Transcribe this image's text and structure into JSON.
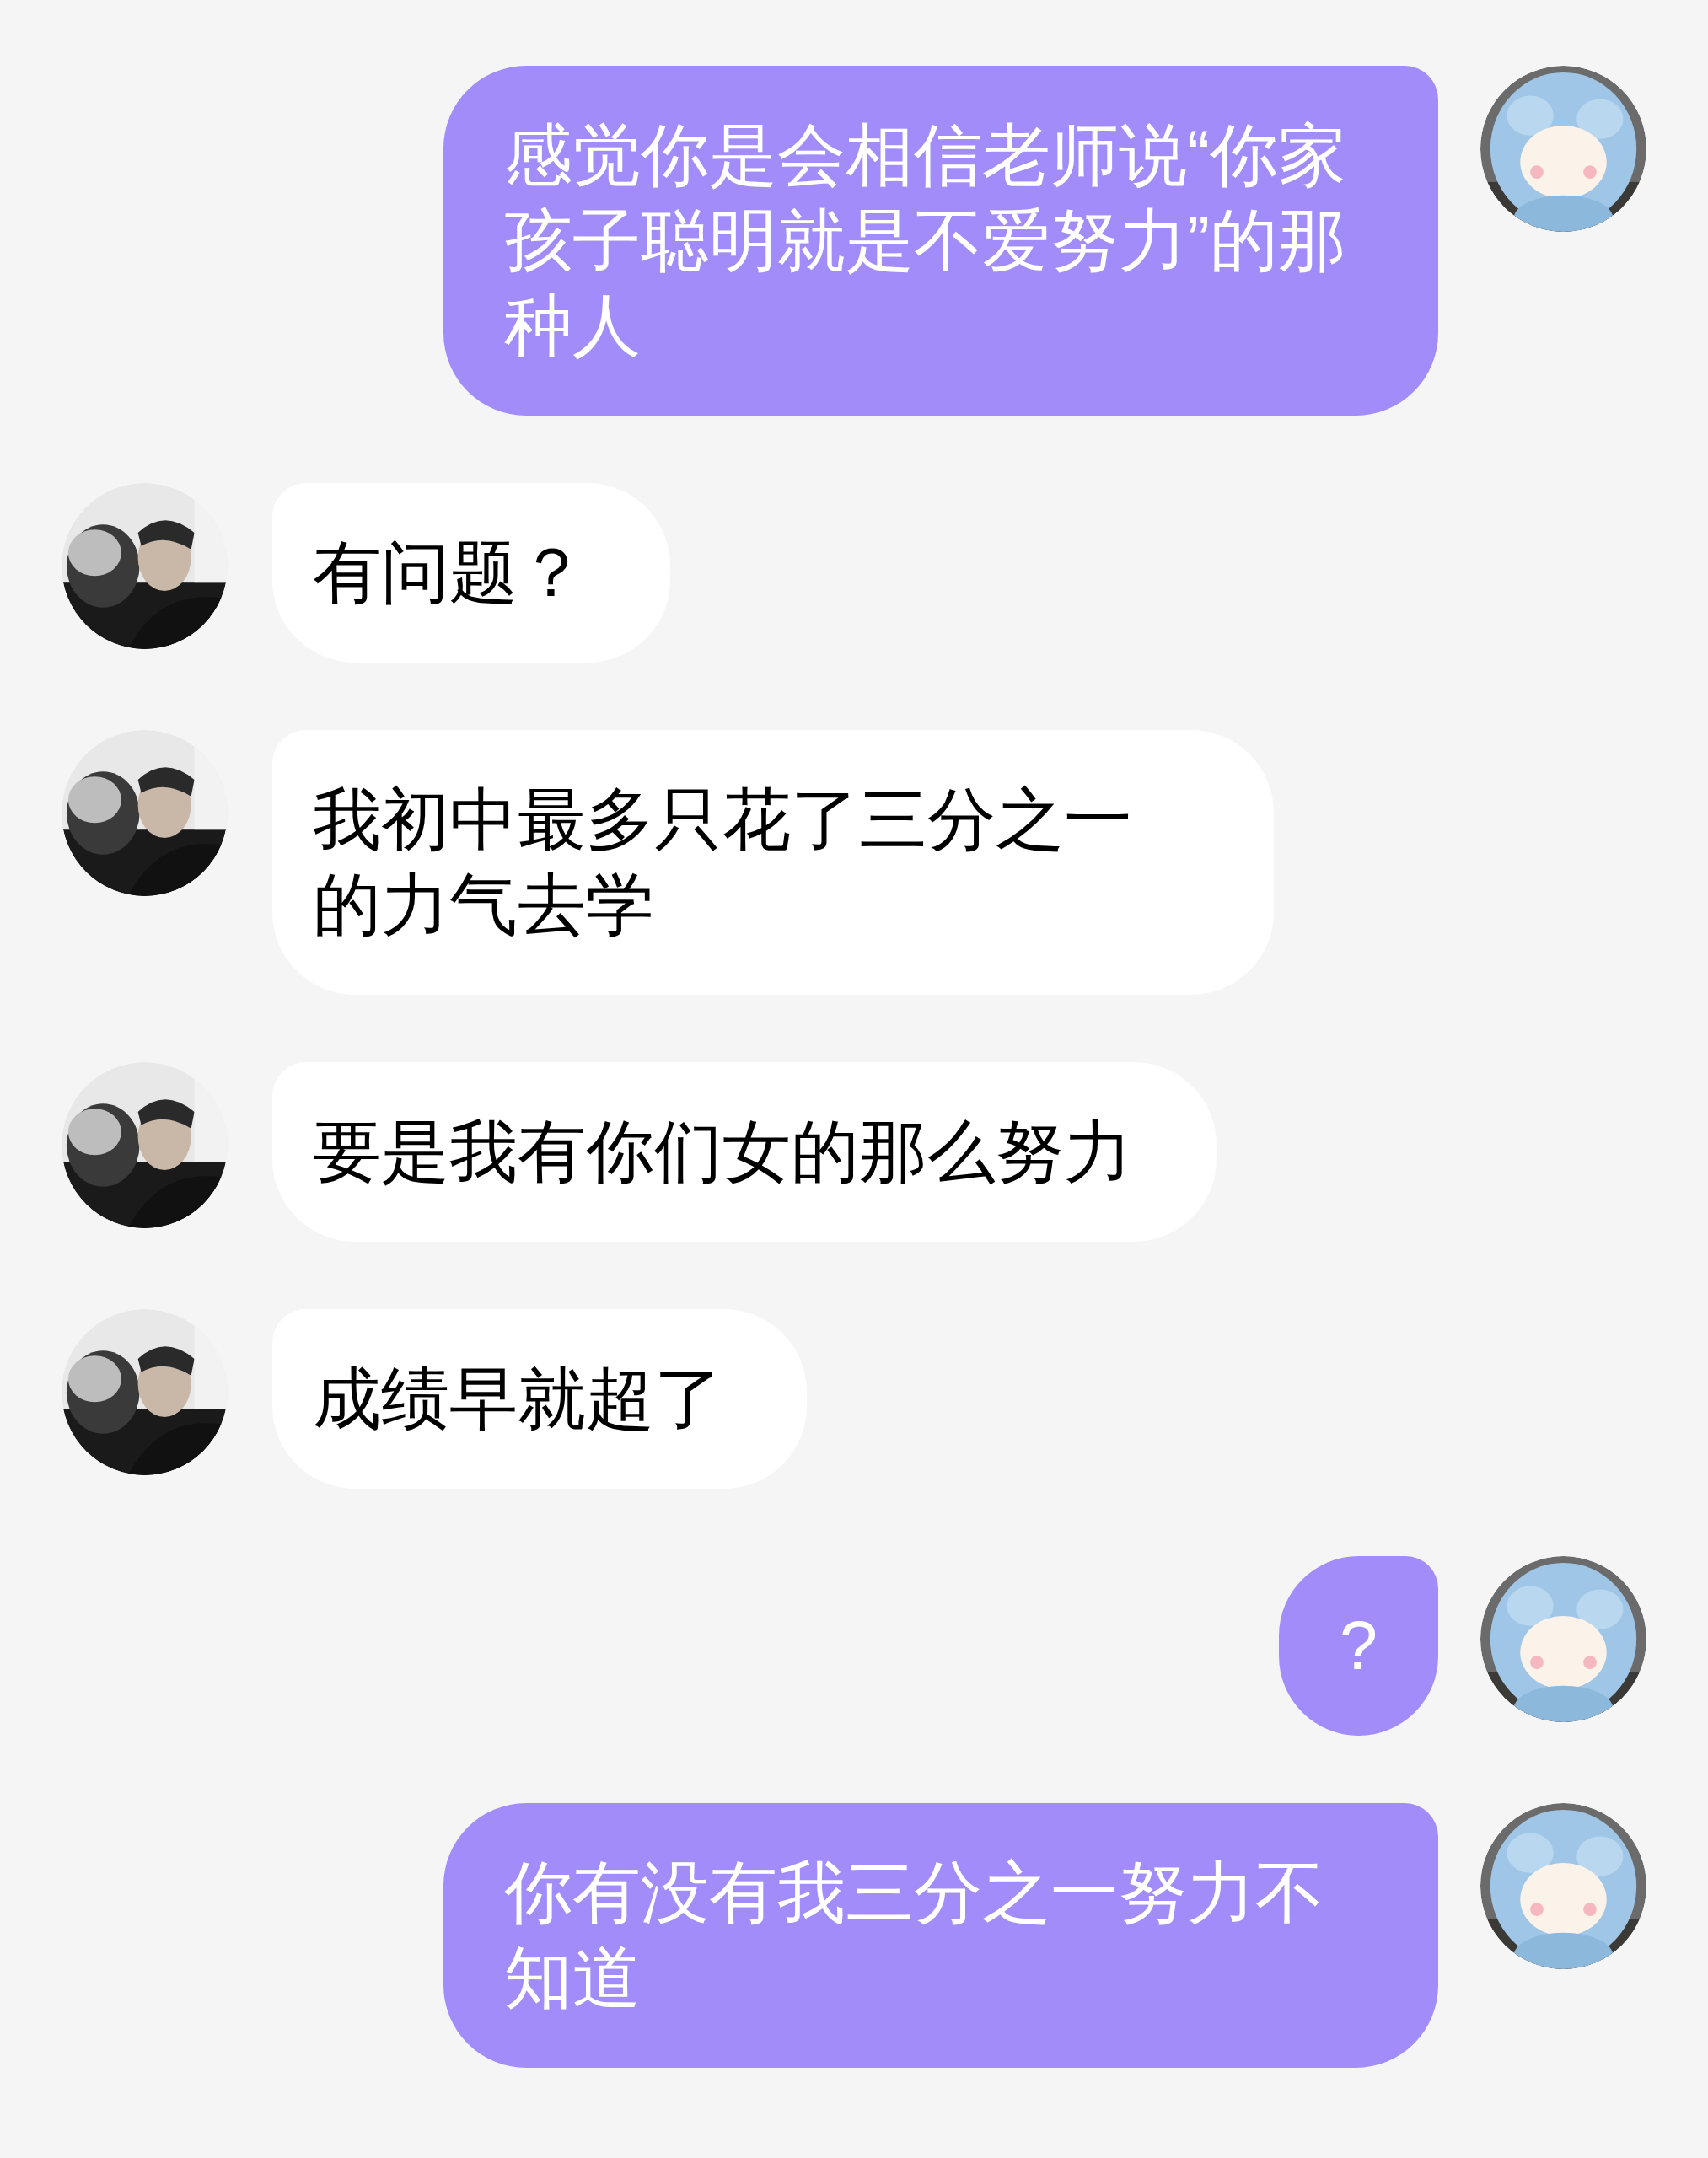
{
  "messages": [
    {
      "kind": "sent",
      "text": "感觉你是会相信老师说“你家孩子聪明就是不爱努力”的那种人"
    },
    {
      "kind": "received",
      "text": "有问题？"
    },
    {
      "kind": "received",
      "text": "我初中最多只花了三分之一的力气去学"
    },
    {
      "kind": "received",
      "text": "要是我有你们女的那么努力"
    },
    {
      "kind": "received",
      "text": "成绩早就超了"
    },
    {
      "kind": "sent",
      "text": "?"
    },
    {
      "kind": "sent",
      "text": "你有没有我三分之一努力不知道"
    }
  ]
}
